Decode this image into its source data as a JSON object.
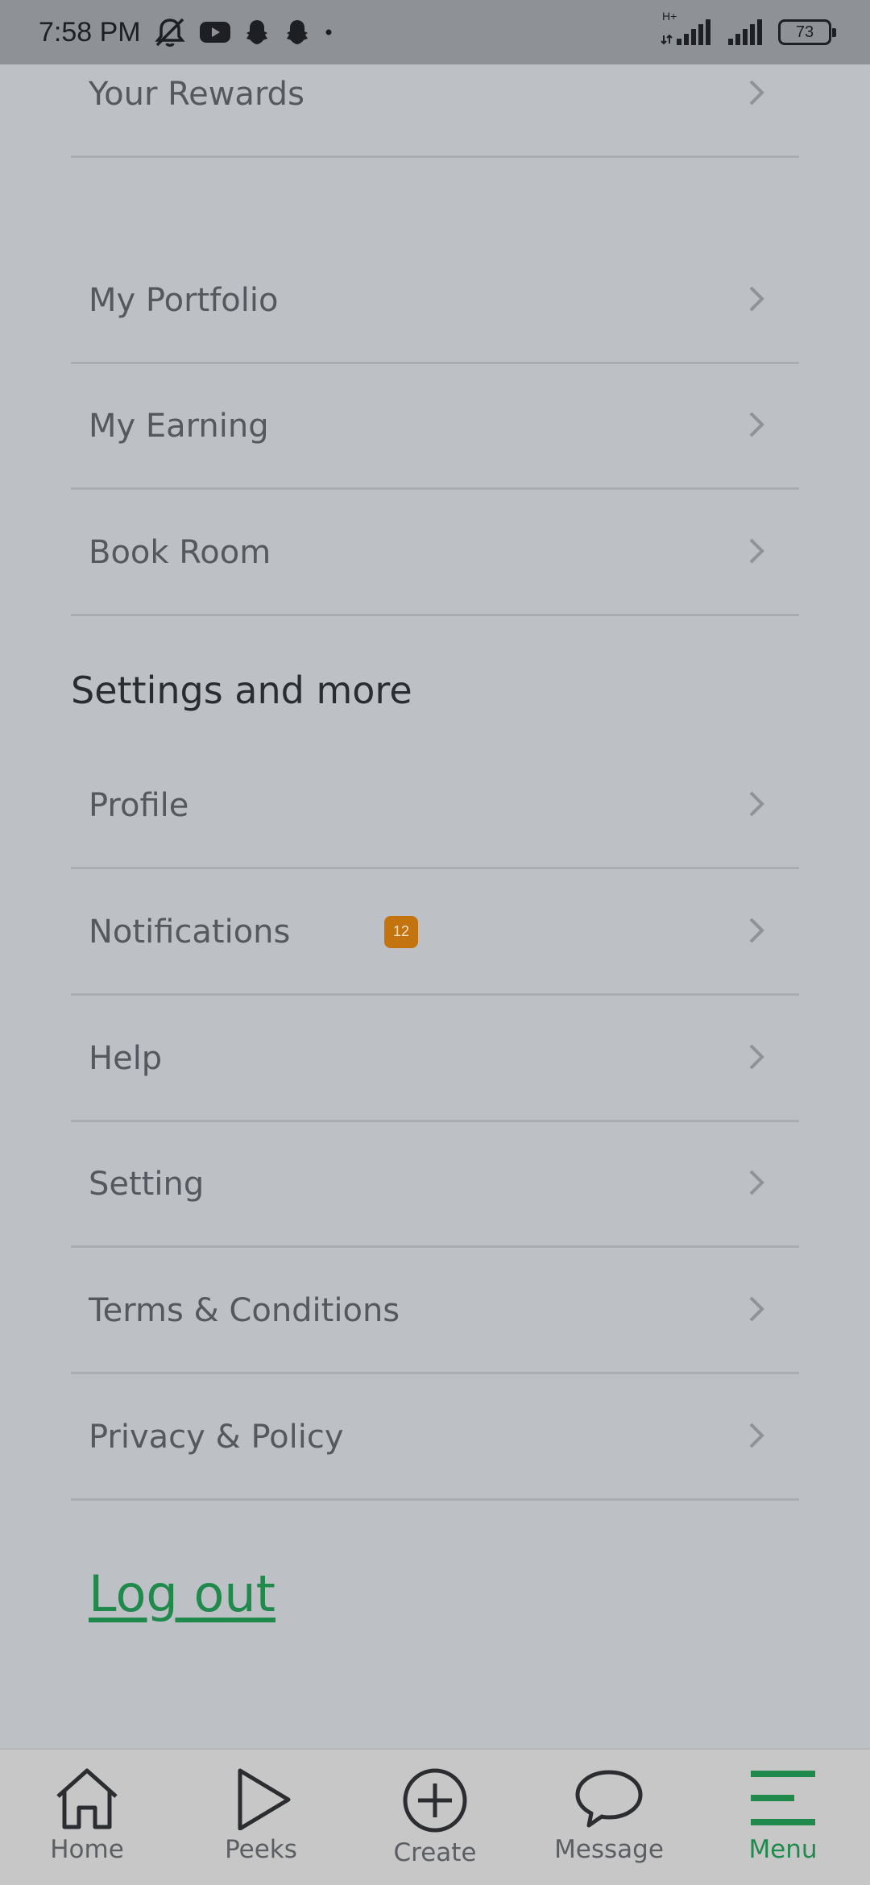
{
  "status_bar": {
    "time": "7:58 PM",
    "icons": [
      "mute-notifications-icon",
      "youtube-icon",
      "snapchat-icon",
      "snapchat-icon",
      "dot-icon"
    ],
    "network_label": "H+",
    "battery": "73"
  },
  "menu_top": [
    {
      "label": "Your Rewards"
    },
    {
      "label": "My Portfolio"
    },
    {
      "label": "My Earning"
    },
    {
      "label": "Book Room"
    }
  ],
  "section_title": "Settings and more",
  "settings_items": [
    {
      "label": "Profile"
    },
    {
      "label": "Notifications",
      "badge": "12"
    },
    {
      "label": "Help"
    },
    {
      "label": "Setting"
    },
    {
      "label": "Terms & Conditions"
    },
    {
      "label": "Privacy & Policy"
    }
  ],
  "logout_label": "Log out",
  "bottom_nav": [
    {
      "label": "Home",
      "icon": "home-icon"
    },
    {
      "label": "Peeks",
      "icon": "play-icon"
    },
    {
      "label": "Create",
      "icon": "plus-circle-icon"
    },
    {
      "label": "Message",
      "icon": "chat-bubble-icon"
    },
    {
      "label": "Menu",
      "icon": "menu-icon",
      "active": true
    }
  ],
  "colors": {
    "accent": "#1f8a4c",
    "badge": "#c4740f",
    "background": "#bdc0c5"
  }
}
